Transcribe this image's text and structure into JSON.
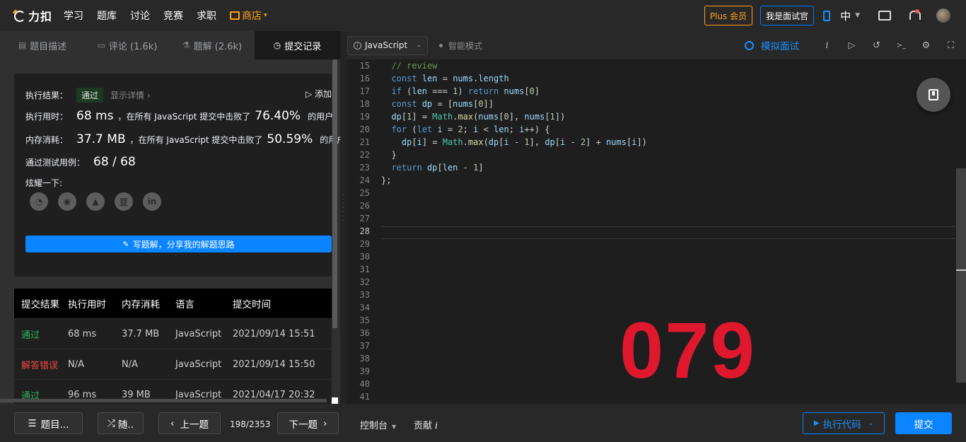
{
  "nav": {
    "logo_text": "力扣",
    "items": [
      "学习",
      "题库",
      "讨论",
      "竞赛",
      "求职"
    ],
    "store_label": "商店",
    "plus_label": "Plus 会员",
    "interviewer_label": "我是面试官",
    "lang_label": "中"
  },
  "left_tabs": [
    {
      "icon": "▤",
      "label": "题目描述"
    },
    {
      "icon": "▭",
      "label": "评论 (1.6k)"
    },
    {
      "icon": "⚗",
      "label": "题解 (2.6k)"
    },
    {
      "icon": "◷",
      "label": "提交记录"
    }
  ],
  "result": {
    "status_label": "执行结果：",
    "status_value": "通过",
    "detail_link": "显示详情 ›",
    "add_note": "▷ 添加",
    "time_label": "执行用时：",
    "time_value": "68 ms",
    "time_mid": "，在所有 JavaScript 提交中击败了",
    "time_pct": "76.40%",
    "time_suffix": "的用户",
    "mem_label": "内存消耗：",
    "mem_value": "37.7 MB",
    "mem_mid": "，在所有 JavaScript 提交中击败了",
    "mem_pct": "50.59%",
    "mem_suffix": "的用户",
    "tests_label": "通过测试用例：",
    "tests_value": "68 / 68",
    "share_label": "炫耀一下:",
    "share_icons": [
      "wechat-icon",
      "weibo-icon",
      "qq-icon",
      "douban-icon",
      "linkedin-icon"
    ],
    "share_glyphs": [
      "◔",
      "◉",
      "▲",
      "豆",
      "in"
    ],
    "write_label": "写题解，分享我的解题思路"
  },
  "submissions": {
    "headers": [
      "提交结果",
      "执行用时",
      "内存消耗",
      "语言",
      "提交时间"
    ],
    "rows": [
      {
        "status": "通过",
        "time": "68 ms",
        "memory": "37.7 MB",
        "lang": "JavaScript",
        "date": "2021/09/14 15:51"
      },
      {
        "status": "解答错误",
        "time": "N/A",
        "memory": "N/A",
        "lang": "JavaScript",
        "date": "2021/09/14 15:50"
      },
      {
        "status": "通过",
        "time": "96 ms",
        "memory": "39 MB",
        "lang": "JavaScript",
        "date": "2021/04/17 20:32"
      }
    ]
  },
  "editor": {
    "language": "JavaScript",
    "smart_mode": "智能模式",
    "mock_interview": "模拟面试",
    "toolbar_icons": [
      "info-icon",
      "run-icon",
      "reset-icon",
      "terminal-icon",
      "settings-icon",
      "fullscreen-icon"
    ],
    "toolbar_glyphs": [
      "i",
      "▷",
      "↺",
      "≻_",
      "⚙",
      "⛶"
    ],
    "code_lines": [
      {
        "n": 15,
        "text": "  // review"
      },
      {
        "n": 16,
        "text": "  const len = nums.length"
      },
      {
        "n": 17,
        "text": "  if (len === 1) return nums[0]"
      },
      {
        "n": 18,
        "text": "  const dp = [nums[0]]"
      },
      {
        "n": 19,
        "text": "  dp[1] = Math.max(nums[0], nums[1])"
      },
      {
        "n": 20,
        "text": "  for (let i = 2; i < len; i++) {"
      },
      {
        "n": 21,
        "text": "    dp[i] = Math.max(dp[i - 1], dp[i - 2] + nums[i])"
      },
      {
        "n": 22,
        "text": "  }"
      },
      {
        "n": 23,
        "text": "  return dp[len - 1]"
      },
      {
        "n": 24,
        "text": "};"
      },
      {
        "n": 25,
        "text": ""
      },
      {
        "n": 26,
        "text": ""
      },
      {
        "n": 27,
        "text": ""
      },
      {
        "n": 28,
        "text": ""
      },
      {
        "n": 29,
        "text": ""
      },
      {
        "n": 30,
        "text": ""
      },
      {
        "n": 31,
        "text": ""
      },
      {
        "n": 32,
        "text": ""
      },
      {
        "n": 33,
        "text": ""
      },
      {
        "n": 34,
        "text": ""
      },
      {
        "n": 35,
        "text": ""
      },
      {
        "n": 36,
        "text": ""
      },
      {
        "n": 37,
        "text": ""
      },
      {
        "n": 38,
        "text": ""
      },
      {
        "n": 39,
        "text": ""
      },
      {
        "n": 40,
        "text": ""
      },
      {
        "n": 41,
        "text": ""
      }
    ],
    "watermark_number": "079"
  },
  "bottom": {
    "problem_list": "题目...",
    "random": "随..",
    "prev": "上一题",
    "page_count": "198/2353",
    "next": "下一题",
    "console": "控制台",
    "contribute": "贡献",
    "contribute_icon": "i",
    "run_code": "执行代码",
    "submit": "提交"
  },
  "colors": {
    "accent": "#0a84ff",
    "pass": "#2db55d",
    "error": "#ef4743",
    "brand_orange": "#ffa116",
    "watermark_red": "#e0182d"
  }
}
